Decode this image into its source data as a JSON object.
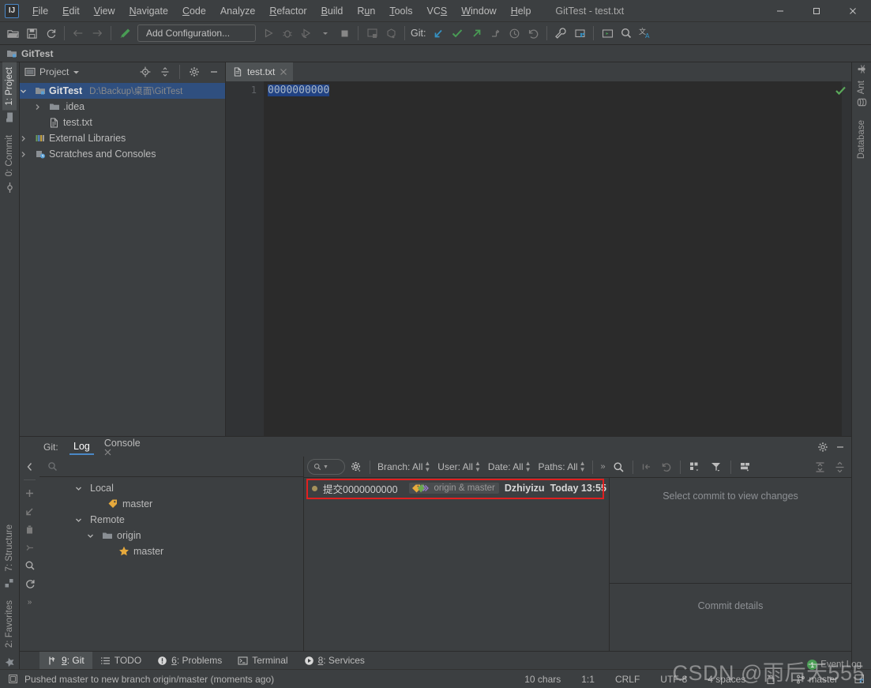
{
  "window": {
    "title": "GitTest - test.txt",
    "minimize_label": "—",
    "maximize_label": "□",
    "close_label": "✕"
  },
  "menu": {
    "items": [
      {
        "label": "File",
        "mnemonic": "F"
      },
      {
        "label": "Edit",
        "mnemonic": "E"
      },
      {
        "label": "View",
        "mnemonic": "V"
      },
      {
        "label": "Navigate",
        "mnemonic": "N"
      },
      {
        "label": "Code",
        "mnemonic": "C"
      },
      {
        "label": "Analyze",
        "mnemonic": "A"
      },
      {
        "label": "Refactor",
        "mnemonic": "R"
      },
      {
        "label": "Build",
        "mnemonic": "B"
      },
      {
        "label": "Run",
        "mnemonic": "u"
      },
      {
        "label": "Tools",
        "mnemonic": "T"
      },
      {
        "label": "VCS",
        "mnemonic": "S"
      },
      {
        "label": "Window",
        "mnemonic": "W"
      },
      {
        "label": "Help",
        "mnemonic": "H"
      }
    ]
  },
  "toolbar": {
    "open_icon": "folder-open-icon",
    "save_icon": "save-icon",
    "sync_icon": "refresh-icon",
    "back_icon": "arrow-left-icon",
    "forward_icon": "arrow-right-icon",
    "build_icon": "hammer-icon",
    "run_config_label": "Add Configuration...",
    "run_icon": "run-icon",
    "debug_icon": "debug-icon",
    "run_coverage_icon": "run-coverage-icon",
    "stop_icon": "stop-icon",
    "git_label": "Git:",
    "update_icon": "update-project-icon",
    "commit_icon": "commit-checkmark-icon",
    "push_icon": "push-icon",
    "branches_icon": "branches-icon",
    "history_icon": "history-icon",
    "rollback_icon": "rollback-icon",
    "settings_icon": "wrench-icon",
    "project_structure_icon": "project-structure-icon",
    "terminal_icon": "terminal-run-icon",
    "search_everywhere_icon": "search-icon",
    "translate_icon": "translate-icon"
  },
  "navbar": {
    "project_icon": "project-module-icon",
    "project_name": "GitTest"
  },
  "left_stripe": {
    "tabs": [
      {
        "label": "1: Project",
        "icon": "project-icon",
        "active": true
      },
      {
        "label": "0: Commit",
        "icon": "commit-icon",
        "active": false
      }
    ],
    "bottom_tabs": [
      {
        "label": "7: Structure",
        "icon": "structure-icon"
      },
      {
        "label": "2: Favorites",
        "icon": "star-icon"
      }
    ]
  },
  "right_stripe": {
    "tabs": [
      {
        "label": "Ant",
        "icon": "ant-icon"
      },
      {
        "label": "Database",
        "icon": "database-icon"
      }
    ]
  },
  "project_panel": {
    "title": "Project",
    "dropdown_icon": "chevron-down-icon",
    "locate_icon": "locate-target-icon",
    "collapse_icon": "collapse-all-icon",
    "settings_icon": "gear-icon",
    "hide_icon": "minimize-icon",
    "tree": [
      {
        "label": "GitTest",
        "path": "D:\\Backup\\桌面\\GitTest",
        "icon": "module-icon",
        "indent": 0,
        "arrow": "expanded",
        "bold": true,
        "selected": true
      },
      {
        "label": ".idea",
        "path": "",
        "icon": "folder-icon",
        "indent": 1,
        "arrow": "collapsed",
        "bold": false,
        "selected": false
      },
      {
        "label": "test.txt",
        "path": "",
        "icon": "text-file-icon",
        "indent": 1,
        "arrow": "none",
        "bold": false,
        "selected": false
      },
      {
        "label": "External Libraries",
        "path": "",
        "icon": "libraries-icon",
        "indent": 0,
        "arrow": "collapsed",
        "bold": false,
        "selected": false
      },
      {
        "label": "Scratches and Consoles",
        "path": "",
        "icon": "scratches-icon",
        "indent": 0,
        "arrow": "collapsed",
        "bold": false,
        "selected": false
      }
    ]
  },
  "editor": {
    "tab_label": "test.txt",
    "tab_icon": "text-file-icon",
    "tab_close_icon": "close-icon",
    "line_number": "1",
    "content": "0000000000",
    "inspection_status_icon": "checkmark-ok-icon"
  },
  "git_window": {
    "label": "Git:",
    "tabs": [
      {
        "label": "Log",
        "active": true,
        "closable": false
      },
      {
        "label": "Console",
        "active": false,
        "closable": true
      }
    ],
    "settings_icon": "gear-icon",
    "hide_icon": "minimize-icon",
    "side_icons": [
      "collapse-left-icon",
      "add-icon",
      "checkout-icon",
      "delete-icon",
      "merge-icon",
      "search-icon",
      "refresh-icon",
      "more-icon"
    ],
    "branch_search_placeholder": "",
    "branch_search_icon": "search-icon",
    "branches": [
      {
        "label": "Local",
        "icon": "none",
        "indent": 0,
        "arrow": "expanded"
      },
      {
        "label": "master",
        "icon": "tag-icon",
        "indent": 1,
        "arrow": "none"
      },
      {
        "label": "Remote",
        "icon": "none",
        "indent": 0,
        "arrow": "expanded"
      },
      {
        "label": "origin",
        "icon": "folder-icon",
        "indent": 1,
        "arrow": "expanded"
      },
      {
        "label": "master",
        "icon": "star-icon",
        "indent": 2,
        "arrow": "none"
      }
    ],
    "log_toolbar": {
      "search_icon": "search-dropdown-icon",
      "settings_icon": "gear-dropdown-icon",
      "filters": [
        {
          "label": "Branch: All"
        },
        {
          "label": "User: All"
        },
        {
          "label": "Date: All"
        },
        {
          "label": "Paths: All"
        }
      ],
      "overflow_label": "»",
      "find_icon": "search-icon",
      "cherry_pick_icon": "cherry-pick-icon",
      "revert_icon": "revert-icon",
      "show_graph_icon": "show-graph-icon",
      "filter_icon": "filter-icon",
      "intellisort_icon": "intellisort-icon",
      "expand_icon": "expand-all-icon",
      "collapse_icon": "collapse-all-icon"
    },
    "commits": [
      {
        "message": "提交0000000000",
        "refs": "origin & master",
        "refs_icon": "branch-labels-icon",
        "author": "Dzhiyizu",
        "date": "Today 13:55",
        "highlighted": true
      }
    ],
    "changes_placeholder": "Select commit to view changes",
    "details_placeholder": "Commit details"
  },
  "bottom_tabs": [
    {
      "label": "9: Git",
      "mnemonic": "9",
      "icon": "git-branch-icon",
      "active": true
    },
    {
      "label": "TODO",
      "mnemonic": "",
      "icon": "todo-icon",
      "active": false
    },
    {
      "label": "6: Problems",
      "mnemonic": "6",
      "icon": "problems-icon",
      "active": false
    },
    {
      "label": "Terminal",
      "mnemonic": "",
      "icon": "terminal-icon",
      "active": false
    },
    {
      "label": "8: Services",
      "mnemonic": "8",
      "icon": "services-icon",
      "active": false
    }
  ],
  "statusbar": {
    "message_icon": "notification-icon",
    "message": "Pushed master to new branch origin/master (moments ago)",
    "chars": "10 chars",
    "caret": "1:1",
    "line_separator": "CRLF",
    "encoding": "UTF-8",
    "indent": "4 spaces",
    "branch": "master",
    "branch_icon": "git-branch-icon",
    "event_log_label": "Event Log",
    "event_log_count": "1",
    "lock_icon": "lock-icon",
    "layout_icon": "layout-icon",
    "watermark": "CSDN @雨后天555"
  },
  "colors": {
    "background": "#3c3f41",
    "editor_background": "#2b2b2b",
    "selection": "#214283",
    "tree_selection": "#2f4f7f",
    "accent": "#4a88c7",
    "highlight_box": "#e02020",
    "success": "#499c54"
  }
}
